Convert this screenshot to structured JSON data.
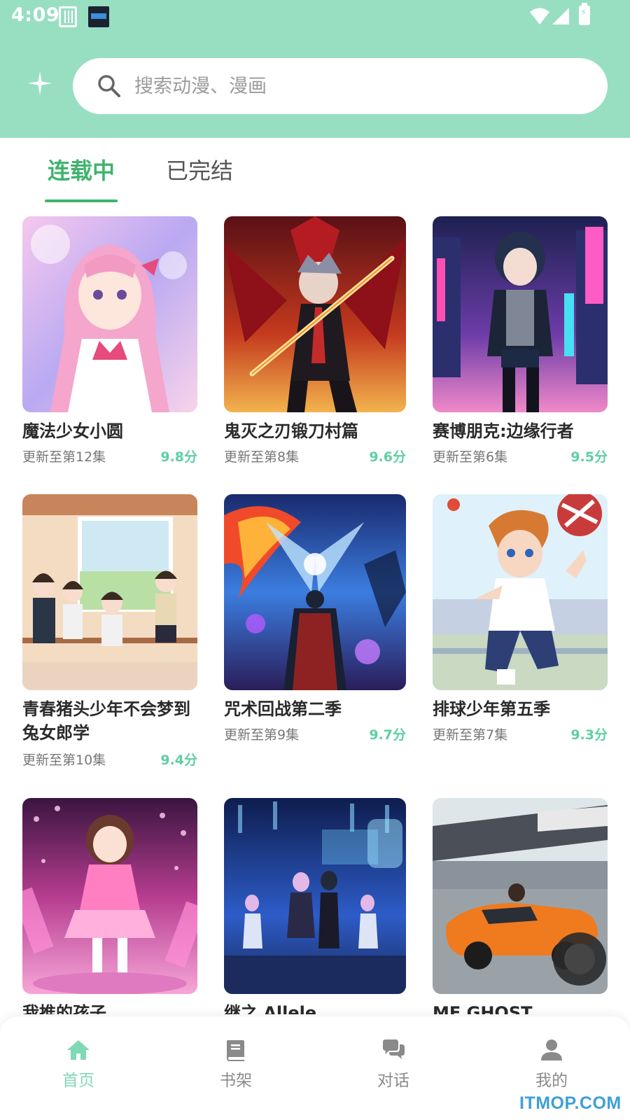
{
  "status_bar": {
    "time": "4:09"
  },
  "colors": {
    "header_bg": "#98dfc2",
    "accent": "#3fb46e",
    "score": "#5ecfa2",
    "nav_active": "#7fd9b5"
  },
  "search": {
    "placeholder": "搜索动漫、漫画"
  },
  "tabs": [
    {
      "label": "连载中",
      "active": true
    },
    {
      "label": "已完结",
      "active": false
    }
  ],
  "items": [
    {
      "title": "魔法少女小圆",
      "update": "更新至第12集",
      "score": "9.8分"
    },
    {
      "title": "鬼灭之刃锻刀村篇",
      "update": "更新至第8集",
      "score": "9.6分"
    },
    {
      "title": "赛博朋克:边缘行者",
      "update": "更新至第6集",
      "score": "9.5分"
    },
    {
      "title": "青春猪头少年不会梦到兔女郎学",
      "update": "更新至第10集",
      "score": "9.4分"
    },
    {
      "title": "咒术回战第二季",
      "update": "更新至第9集",
      "score": "9.7分"
    },
    {
      "title": "排球少年第五季",
      "update": "更新至第7集",
      "score": "9.3分"
    },
    {
      "title": "我推的孩子"
    },
    {
      "title": "继之 Allele"
    },
    {
      "title": "MF GHOST"
    }
  ],
  "nav": [
    {
      "label": "首页",
      "icon": "home-icon",
      "active": true
    },
    {
      "label": "书架",
      "icon": "book-icon",
      "active": false
    },
    {
      "label": "对话",
      "icon": "chat-icon",
      "active": false
    },
    {
      "label": "我的",
      "icon": "user-icon",
      "active": false
    }
  ],
  "watermark": "ITMOP.COM"
}
